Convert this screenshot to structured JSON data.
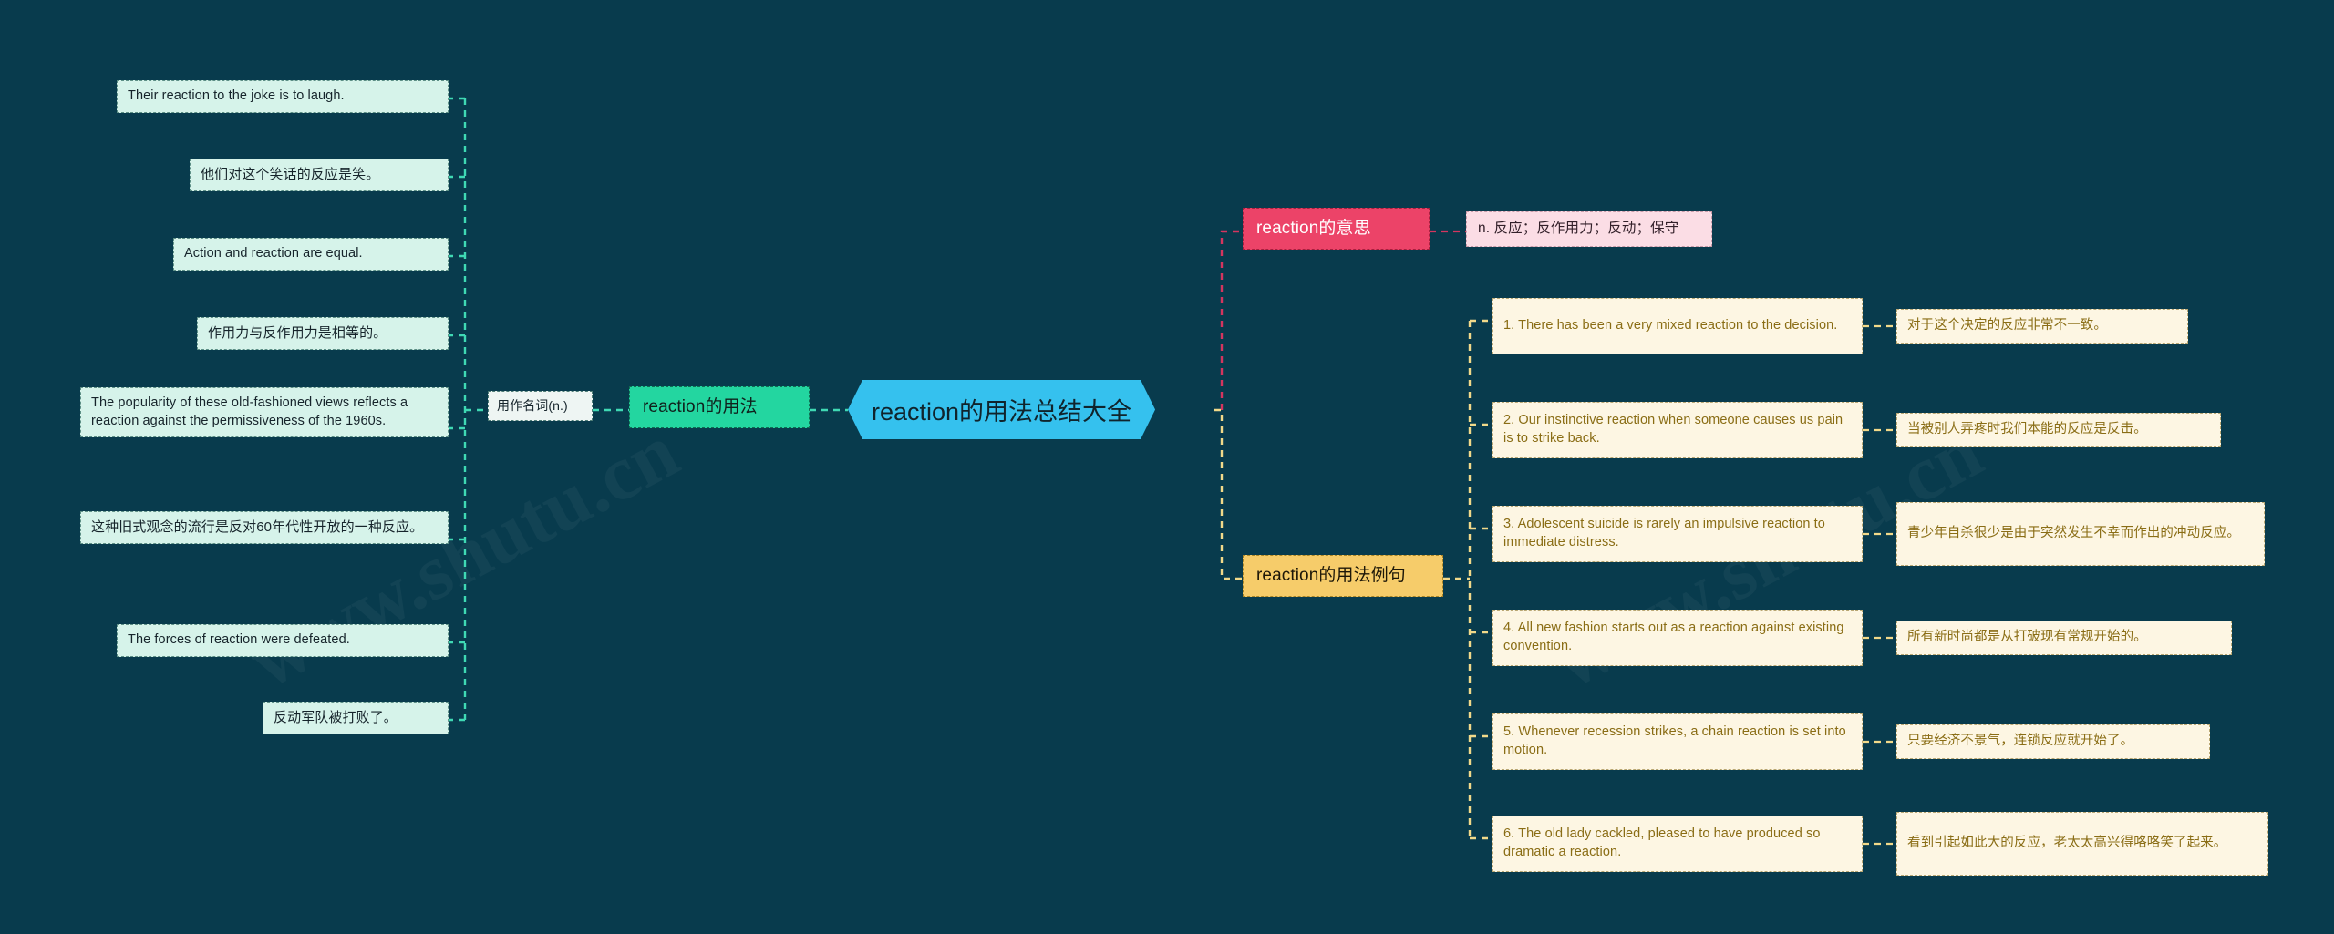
{
  "colors": {
    "background": "#083b4d",
    "center_node": "#35c1ee",
    "usage_node": "#23d6a0",
    "meaning_node": "#ec4368",
    "meaning_value_node": "#fbdde5",
    "examples_node": "#f6cc6a",
    "leaf_node": "#d6f3ea",
    "example_card": "#fdf6e3",
    "link_teal": "#3fd9b4",
    "link_pink": "#d4355f",
    "link_yellow": "#f1d98a"
  },
  "watermark": {
    "left": "www.shutu.cn",
    "right": "www.shutu.cn"
  },
  "center": {
    "title": "reaction的用法总结大全"
  },
  "usage_branch": {
    "label": "reaction的用法",
    "pos_label": "用作名词(n.)",
    "leaves": [
      {
        "id": 1,
        "lang": "en",
        "text": "Their reaction to the joke is to laugh."
      },
      {
        "id": 2,
        "lang": "cn",
        "text": "他们对这个笑话的反应是笑。"
      },
      {
        "id": 3,
        "lang": "en",
        "text": "Action and reaction are equal."
      },
      {
        "id": 4,
        "lang": "cn",
        "text": "作用力与反作用力是相等的。"
      },
      {
        "id": 5,
        "lang": "en",
        "text": "The popularity of these old-fashioned views reflects a reaction against the permissiveness of the 1960s."
      },
      {
        "id": 6,
        "lang": "cn",
        "text": "这种旧式观念的流行是反对60年代性开放的一种反应。"
      },
      {
        "id": 7,
        "lang": "en",
        "text": "The forces of reaction were defeated."
      },
      {
        "id": 8,
        "lang": "cn",
        "text": "反动军队被打败了。"
      }
    ]
  },
  "meaning_branch": {
    "label": "reaction的意思",
    "value": "n. 反应；反作用力；反动；保守"
  },
  "examples_branch": {
    "label": "reaction的用法例句",
    "items": [
      {
        "n": 1,
        "en": "1. There has been a very mixed reaction to the decision.",
        "cn": "对于这个决定的反应非常不一致。"
      },
      {
        "n": 2,
        "en": "2. Our instinctive reaction when someone causes us pain is to strike back.",
        "cn": "当被别人弄疼时我们本能的反应是反击。"
      },
      {
        "n": 3,
        "en": "3. Adolescent suicide is rarely an impulsive reaction to immediate distress.",
        "cn": "青少年自杀很少是由于突然发生不幸而作出的冲动反应。"
      },
      {
        "n": 4,
        "en": "4. All new fashion starts out as a reaction against existing convention.",
        "cn": "所有新时尚都是从打破现有常规开始的。"
      },
      {
        "n": 5,
        "en": "5. Whenever recession strikes, a chain reaction is set into motion.",
        "cn": "只要经济不景气，连锁反应就开始了。"
      },
      {
        "n": 6,
        "en": "6. The old lady cackled, pleased to have produced so dramatic a reaction.",
        "cn": "看到引起如此大的反应，老太太高兴得咯咯笑了起来。"
      }
    ]
  }
}
